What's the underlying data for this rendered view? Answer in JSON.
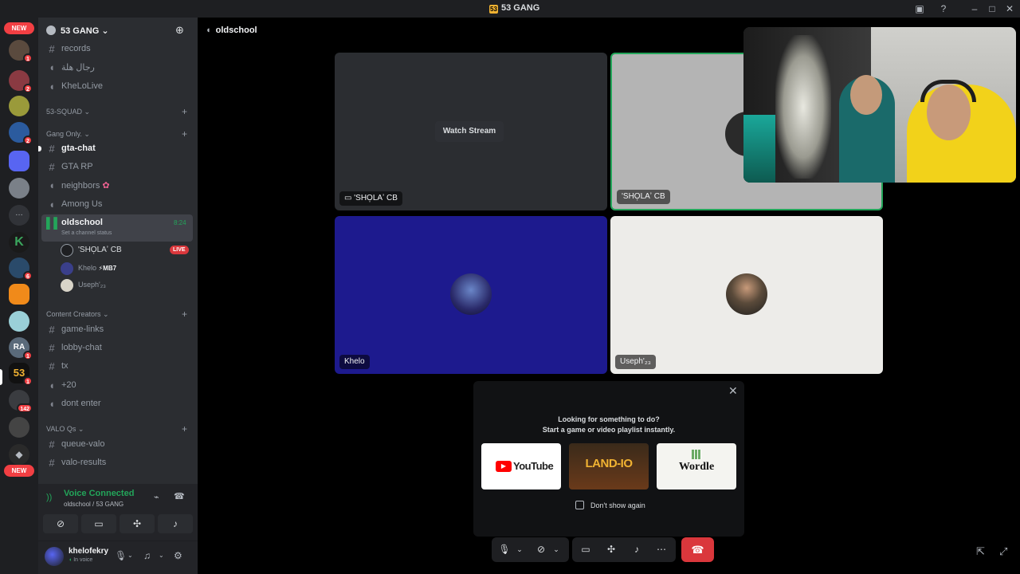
{
  "window": {
    "title": "53 GANG",
    "logo_text": "53"
  },
  "rail": {
    "new_top": "NEW",
    "new_bottom": "NEW",
    "badges": [
      "1",
      "2",
      "2",
      "6",
      "1",
      "1",
      "142"
    ]
  },
  "server": {
    "name": "53 GANG"
  },
  "channels": {
    "records": "records",
    "arabic": "رجال هلة",
    "khelolive": "KheLoLive",
    "cat_squad": "53-SQUAD",
    "cat_gang": "Gang Only.",
    "gta_chat": "gta-chat",
    "gta_rp": "GTA RP",
    "neighbors": "neighbors",
    "neighbors_emoji": "✿",
    "among_us": "Among Us",
    "oldschool": "oldschool",
    "oldschool_time": "8:24",
    "oldschool_status": "Set a channel status",
    "cat_creators": "Content Creators",
    "game_links": "game-links",
    "lobby_chat": "lobby-chat",
    "tx": "tx",
    "plus20": "+20",
    "dont_enter": "dont enter",
    "cat_valo": "VALO Qs",
    "queue_valo": "queue-valo",
    "valo_results": "valo-results"
  },
  "voice_users": [
    {
      "name": "'SHO̩LAʼ CB",
      "live": "LIVE"
    },
    {
      "name": "Khelo",
      "tag": "⚡MB7"
    },
    {
      "name": "Useph'₂₃"
    }
  ],
  "voice_panel": {
    "status": "Voice Connected",
    "location": "oldschool / 53 GANG"
  },
  "user_panel": {
    "username": "khelofekry",
    "status": "In voice"
  },
  "main": {
    "channel": "oldschool",
    "watch_stream": "Watch Stream",
    "tiles": [
      {
        "label": "'SHO̩LAʼ CB"
      },
      {
        "label": "'SHO̩LAʼ CB"
      },
      {
        "label": "Khelo"
      },
      {
        "label": "Useph'₂₃"
      }
    ]
  },
  "activity": {
    "line1": "Looking for something to do?",
    "line2": "Start a game or video playlist instantly.",
    "cards": [
      "YouTube",
      "LAND-IO",
      "Wordle"
    ],
    "dont_show": "Don't show again"
  },
  "colors": {
    "accent_green": "#23a55a",
    "live_red": "#da373c",
    "tile_blue": "#1d1a8e",
    "tile_light": "#edece9"
  }
}
